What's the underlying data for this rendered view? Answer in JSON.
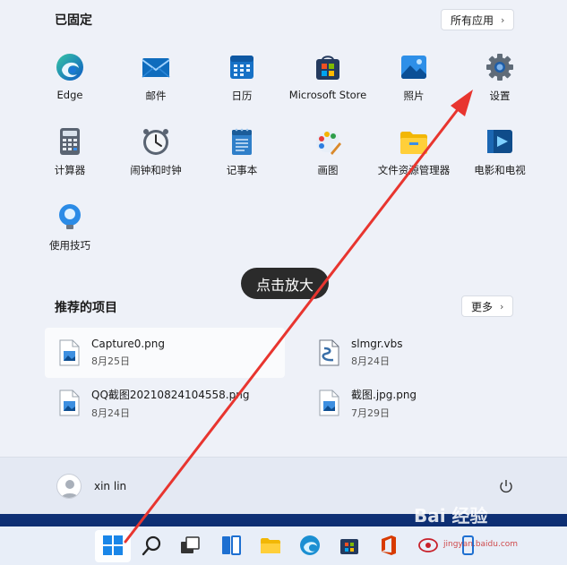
{
  "pinned": {
    "title": "已固定",
    "all_apps_label": "所有应用",
    "apps": [
      {
        "label": "Edge",
        "icon": "edge-icon"
      },
      {
        "label": "邮件",
        "icon": "mail-icon"
      },
      {
        "label": "日历",
        "icon": "calendar-icon"
      },
      {
        "label": "Microsoft Store",
        "icon": "store-icon"
      },
      {
        "label": "照片",
        "icon": "photos-icon"
      },
      {
        "label": "设置",
        "icon": "gear-icon"
      },
      {
        "label": "计算器",
        "icon": "calculator-icon"
      },
      {
        "label": "闹钟和时钟",
        "icon": "clock-icon"
      },
      {
        "label": "记事本",
        "icon": "notepad-icon"
      },
      {
        "label": "画图",
        "icon": "paint-icon"
      },
      {
        "label": "文件资源管理器",
        "icon": "folder-icon"
      },
      {
        "label": "电影和电视",
        "icon": "movies-icon"
      },
      {
        "label": "使用技巧",
        "icon": "tips-icon"
      }
    ]
  },
  "tooltip": "点击放大",
  "recommended": {
    "title": "推荐的项目",
    "more_label": "更多",
    "items": [
      {
        "name": "Capture0.png",
        "date": "8月25日"
      },
      {
        "name": "slmgr.vbs",
        "date": "8月24日"
      },
      {
        "name": "QQ截图20210824104558.png",
        "date": "8月24日"
      },
      {
        "name": "截图.jpg.png",
        "date": "7月29日"
      }
    ]
  },
  "user": {
    "name": "xin lin"
  },
  "watermark": {
    "text": "Bai 经验",
    "sub": "jingyan.baidu.com"
  },
  "colors": {
    "accent": "#0067c0",
    "arrow": "#e8352f"
  }
}
